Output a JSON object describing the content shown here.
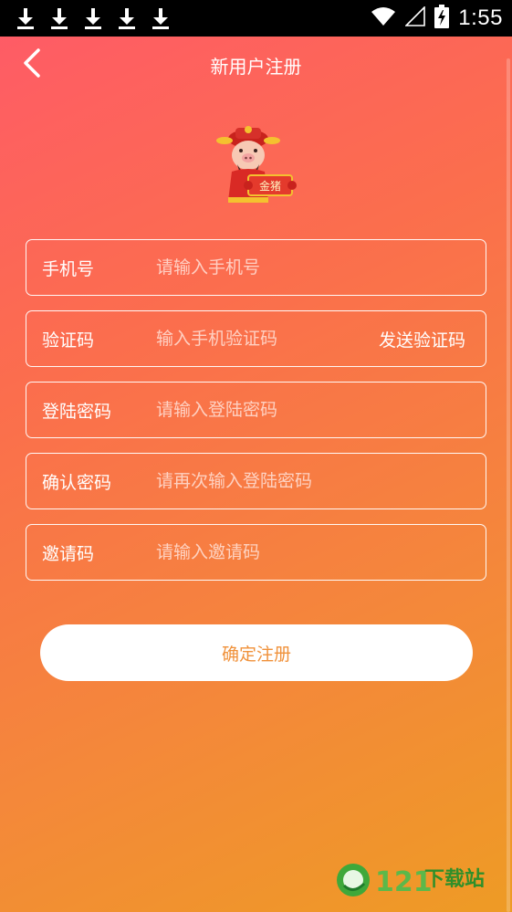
{
  "status_bar": {
    "time": "1:55",
    "notification_icons": [
      "download-icon",
      "download-icon",
      "download-icon",
      "download-icon",
      "download-icon"
    ],
    "system_icons": [
      "wifi-icon",
      "signal-icon",
      "battery-charging-icon"
    ]
  },
  "header": {
    "title": "新用户注册",
    "back_icon": "chevron-left-icon"
  },
  "mascot": {
    "icon": "golden-pig-god-of-wealth-mascot",
    "scroll_text": "金猪"
  },
  "form": {
    "fields": [
      {
        "label": "手机号",
        "placeholder": "请输入手机号",
        "value": ""
      },
      {
        "label": "验证码",
        "placeholder": "输入手机验证码",
        "value": "",
        "action": "发送验证码"
      },
      {
        "label": "登陆密码",
        "placeholder": "请输入登陆密码",
        "value": ""
      },
      {
        "label": "确认密码",
        "placeholder": "请再次输入登陆密码",
        "value": ""
      },
      {
        "label": "邀请码",
        "placeholder": "请输入邀请码",
        "value": ""
      }
    ],
    "submit_label": "确定注册"
  },
  "watermark": {
    "number": "121",
    "text": "下载站"
  },
  "colors": {
    "gradient_start": "#ff5a68",
    "gradient_end": "#ee9b25",
    "submit_text": "#f0913a",
    "status_bar": "#000000"
  }
}
